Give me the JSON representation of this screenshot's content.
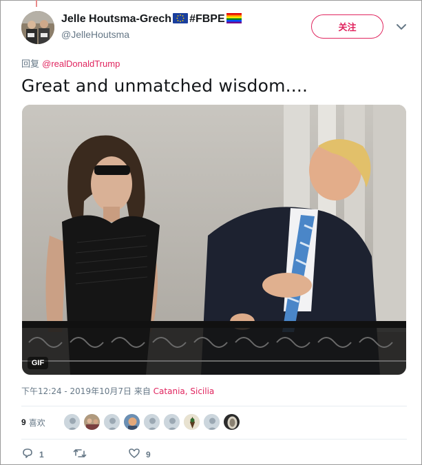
{
  "tweet": {
    "author": {
      "display_name": "Jelle Houtsma-Grech",
      "flag_icon": "eu-flag-icon",
      "hashtag": "#FBPE",
      "badge_icon": "rainbow-flag-icon",
      "handle": "@JelleHoutsma"
    },
    "follow_label": "关注",
    "reply_prefix": "回复",
    "reply_mention": "@realDonaldTrump",
    "text": "Great and unmatched wisdom....",
    "media": {
      "type": "gif",
      "badge": "GIF"
    },
    "timestamp": "下午12:24 - 2019年10月7日",
    "from_label": "来自",
    "location": "Catania, Sicilia",
    "likes": {
      "count": "9",
      "label": "喜欢"
    },
    "actions": {
      "reply_count": "1",
      "retweet_count": "",
      "like_count": "9"
    }
  },
  "colors": {
    "accent": "#e0245e",
    "muted": "#657786",
    "text": "#14171a"
  }
}
